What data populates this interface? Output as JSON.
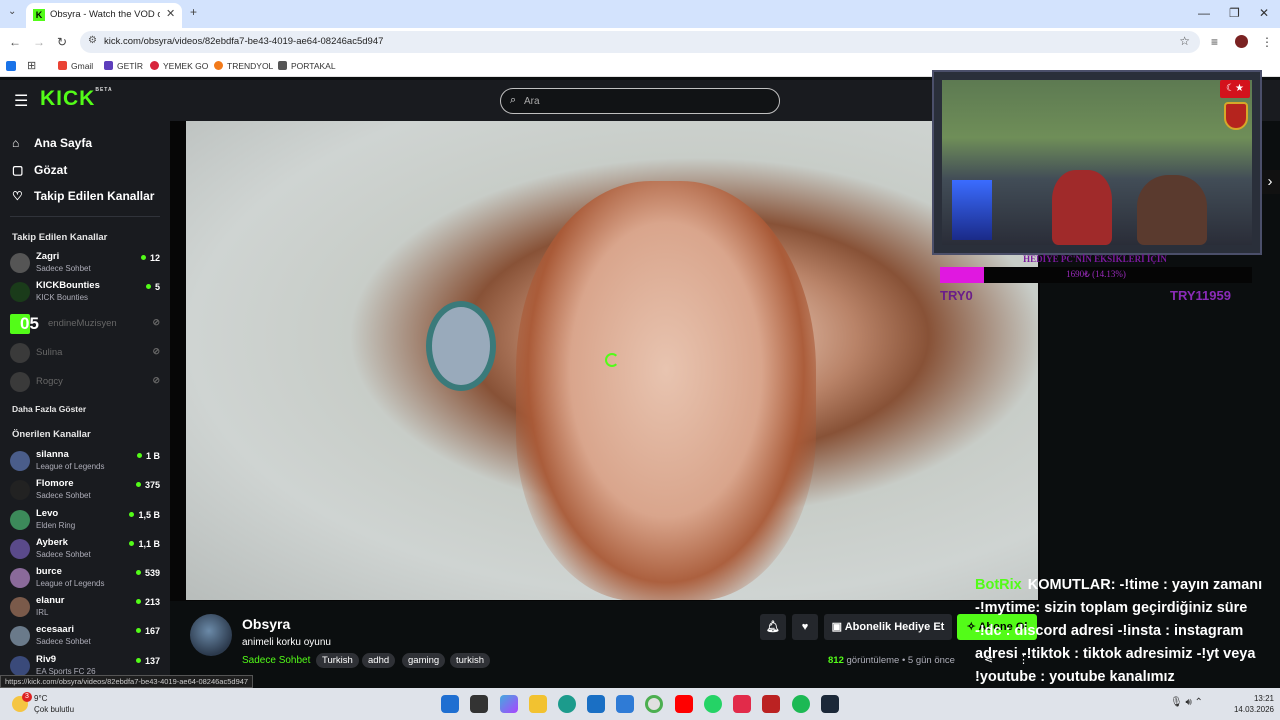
{
  "browser": {
    "tab_title": "Obsyra - Watch the VOD on Kick",
    "url": "kick.com/obsyra/videos/82ebdfa7-be43-4019-ae64-08246ac5d947",
    "bookmarks": [
      "Gmail",
      "GETİR",
      "YEMEK GO",
      "TRENDYOL",
      "PORTAKAL"
    ]
  },
  "header": {
    "logo": "KICK",
    "logo_badge": "BETA",
    "search_placeholder": "Ara"
  },
  "sidebar": {
    "nav": [
      "Ana Sayfa",
      "Gözat",
      "Takip Edilen Kanallar"
    ],
    "following_title": "Takip Edilen Kanallar",
    "following": [
      {
        "name": "Zagri",
        "sub": "Sadece Sohbet",
        "viewers": "12",
        "live": true
      },
      {
        "name": "KICKBounties",
        "sub": "KICK Bounties",
        "viewers": "5",
        "live": true
      },
      {
        "name": "endineMuzisyen",
        "sub": "",
        "viewers": "",
        "live": false
      },
      {
        "name": "Sulina",
        "sub": "",
        "viewers": "",
        "live": false
      },
      {
        "name": "Rogcy",
        "sub": "",
        "viewers": "",
        "live": false
      }
    ],
    "overlay_number": "05",
    "show_more": "Daha Fazla Göster",
    "recommended_title": "Önerilen Kanallar",
    "recommended": [
      {
        "name": "silanna",
        "sub": "League of Legends",
        "viewers": "1 B"
      },
      {
        "name": "Flomore",
        "sub": "Sadece Sohbet",
        "viewers": "375"
      },
      {
        "name": "Levo",
        "sub": "Elden Ring",
        "viewers": "1,5 B"
      },
      {
        "name": "Ayberk",
        "sub": "Sadece Sohbet",
        "viewers": "1,1 B"
      },
      {
        "name": "burce",
        "sub": "League of Legends",
        "viewers": "539"
      },
      {
        "name": "elanur",
        "sub": "IRL",
        "viewers": "213"
      },
      {
        "name": "ecesaari",
        "sub": "Sadece Sohbet",
        "viewers": "167"
      },
      {
        "name": "Riv9",
        "sub": "EA Sports FC 26",
        "viewers": "137"
      }
    ]
  },
  "stream": {
    "streamer": "Obsyra",
    "title": "animeli korku oyunu",
    "category": "Sadece Sohbet",
    "tags": [
      "Turkish",
      "adhd",
      "gaming",
      "turkish"
    ],
    "views_count": "812",
    "views_label": "görüntüleme",
    "time_ago": "5 gün önce",
    "gift_button": "Abonelik Hediye Et",
    "subscribe_button": "Abone Ol"
  },
  "overlay": {
    "goal_title": "HEDİYE PC'NİN EKSİKLERİ İÇİN",
    "goal_progress_text": "1690₺ (14.13%)",
    "goal_fraction": 0.1413,
    "goal_left": "TRY0",
    "goal_right": "TRY11959",
    "flag": "☾★"
  },
  "chat": {
    "user": "BotRix",
    "message": "KOMUTLAR: -!time : yayın zamanı -!mytime: sizin toplam geçirdiğiniz süre -!dc : discord adresi -!insta : instagram adresi -!tiktok : tiktok adresimiz -!yt veya !youtube : youtube kanalımız"
  },
  "status_link": "https://kick.com/obsyra/videos/82ebdfa7-be43-4019-ae64-08246ac5d947",
  "taskbar": {
    "weather_temp": "9°C",
    "weather_desc": "Çok bulutlu",
    "weather_badge": "3",
    "time": "13:21",
    "date": "14.03.2026"
  },
  "colors": {
    "kick_green": "#53fc18",
    "sidebar_bg": "#191b1f",
    "goal_fill": "#e018e0"
  }
}
